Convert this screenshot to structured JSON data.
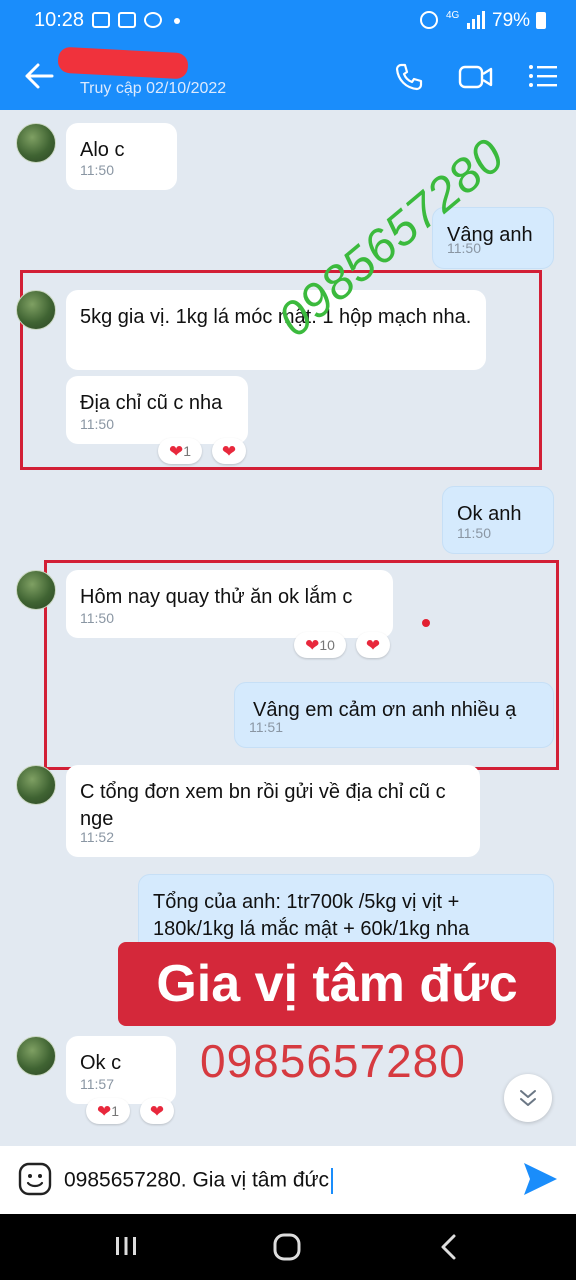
{
  "status_bar": {
    "time": "10:28",
    "net_label": "4G",
    "battery": "79%"
  },
  "header": {
    "contact_subtitle": "Truy cập 02/10/2022"
  },
  "messages": [
    {
      "text": "Alo c",
      "time": "11:50"
    },
    {
      "text": "Vâng anh",
      "time": "11:50"
    },
    {
      "text": "5kg gia vị. 1kg lá móc mật. 1 hộp mạch nha.",
      "time": ""
    },
    {
      "text": "Địa chỉ cũ c nha",
      "time": "11:50",
      "reaction_count": "1"
    },
    {
      "text": "Ok anh",
      "time": "11:50"
    },
    {
      "text": "Hôm nay quay thử ăn ok lắm c",
      "time": "11:50",
      "reaction_count": "10"
    },
    {
      "text": "Vâng em cảm ơn anh nhiều ạ",
      "time": "11:51"
    },
    {
      "text": "C tổng đơn xem bn rồi gửi về địa chỉ cũ c nge",
      "time": "11:52"
    },
    {
      "text": "Tổng của anh: 1tr700k /5kg vị vịt + 180k/1kg lá mắc mật + 60k/1kg nha",
      "time": ""
    },
    {
      "text": "Ok c",
      "time": "11:57",
      "reaction_count": "1"
    }
  ],
  "overlays": {
    "watermark_phone": "0985657280",
    "banner": "Gia vị tâm đức",
    "phone": "0985657280"
  },
  "composer": {
    "value": "0985657280. Gia vị tâm đức"
  },
  "colors": {
    "header_blue": "#1a8dfb",
    "chat_bg": "#e2e9f1",
    "outgoing_bubble": "#d5eafd",
    "highlight_red": "#d21f36",
    "watermark_green": "#3bba3d"
  }
}
